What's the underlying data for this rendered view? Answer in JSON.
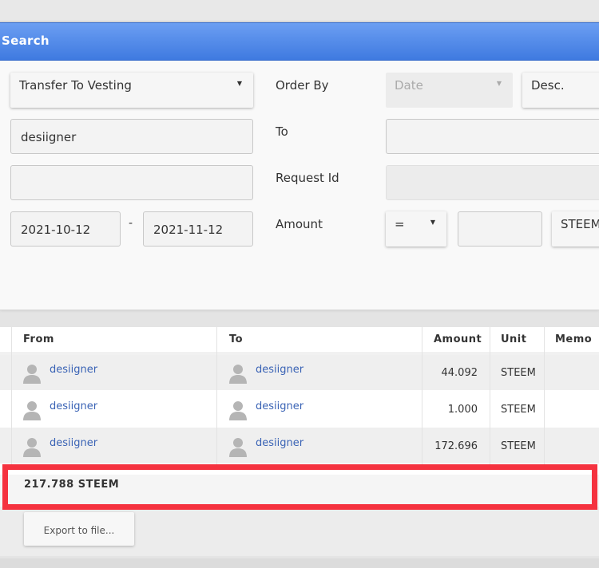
{
  "header": {
    "title": "Search"
  },
  "form": {
    "operation": "Transfer To Vesting",
    "order_by_label": "Order By",
    "order_by_field": "Date",
    "order_direction": "Desc.",
    "from_value": "desiigner",
    "to_label": "To",
    "to_value": "",
    "request_id_label": "Request Id",
    "date_from": "2021-10-12",
    "date_sep": "-",
    "date_to": "2021-11-12",
    "amount_label": "Amount",
    "amount_operator": "=",
    "amount_value": "",
    "amount_unit": "STEEM"
  },
  "table": {
    "columns": [
      "From",
      "To",
      "Amount",
      "Unit",
      "Memo"
    ],
    "rows": [
      {
        "from": "desiigner",
        "to": "desiigner",
        "amount": "44.092",
        "unit": "STEEM",
        "memo": ""
      },
      {
        "from": "desiigner",
        "to": "desiigner",
        "amount": "1.000",
        "unit": "STEEM",
        "memo": ""
      },
      {
        "from": "desiigner",
        "to": "desiigner",
        "amount": "172.696",
        "unit": "STEEM",
        "memo": ""
      }
    ]
  },
  "summary": {
    "total": "217.788 STEEM"
  },
  "export_label": "Export to file...",
  "colors": {
    "header": "#4a86e8",
    "link": "#3a63b5",
    "highlight": "#f5323f"
  }
}
